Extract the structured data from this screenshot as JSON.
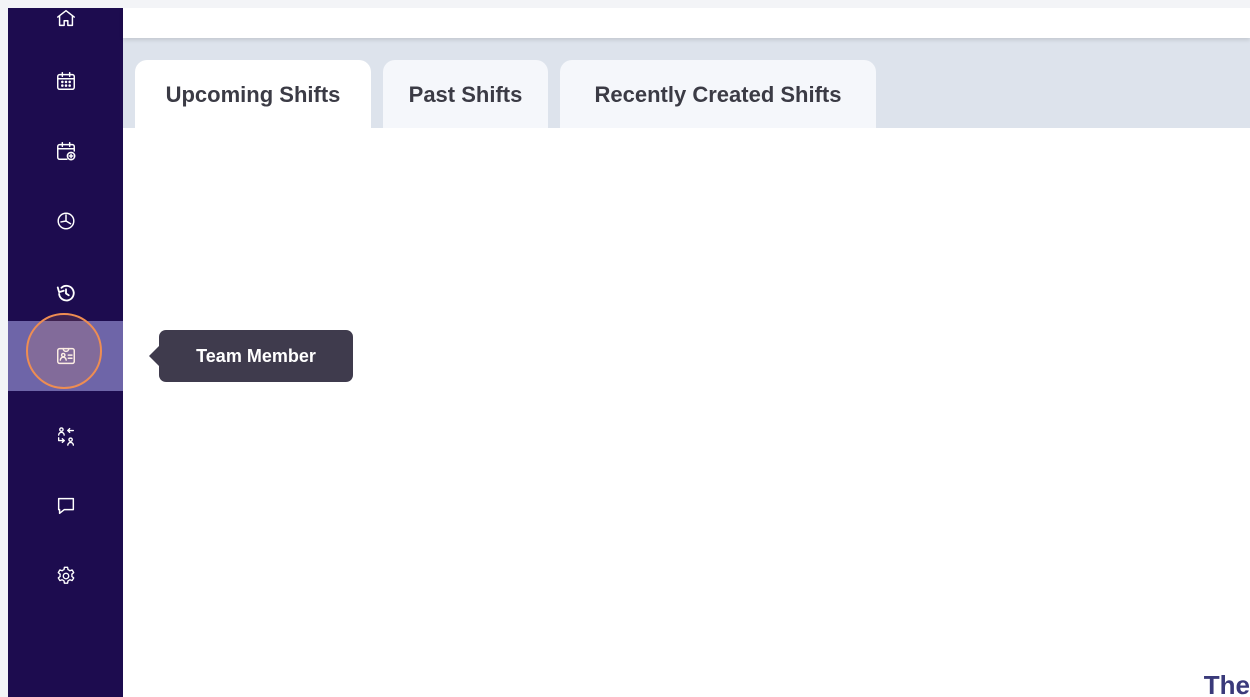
{
  "colors": {
    "sidebar": "#1d0c4f",
    "sidebar_active": "#6e65a8",
    "focus_ring": "#ee8d52",
    "tabstrip": "#dde3ec",
    "tooltip": "#3f3b4d"
  },
  "sidebar": {
    "items": [
      {
        "icon": "home-icon"
      },
      {
        "icon": "calendar-icon"
      },
      {
        "icon": "calendar-add-icon"
      },
      {
        "icon": "clock-icon"
      },
      {
        "icon": "history-icon"
      },
      {
        "icon": "team-member-icon",
        "active": true
      },
      {
        "icon": "swap-users-icon"
      },
      {
        "icon": "chat-icon"
      },
      {
        "icon": "gear-icon"
      }
    ]
  },
  "tooltip": {
    "text": "Team Member"
  },
  "tabs": [
    {
      "label": "Upcoming Shifts",
      "active": true
    },
    {
      "label": "Past Shifts"
    },
    {
      "label": "Recently Created Shifts"
    }
  ],
  "footer": {
    "partial_text": "The"
  }
}
